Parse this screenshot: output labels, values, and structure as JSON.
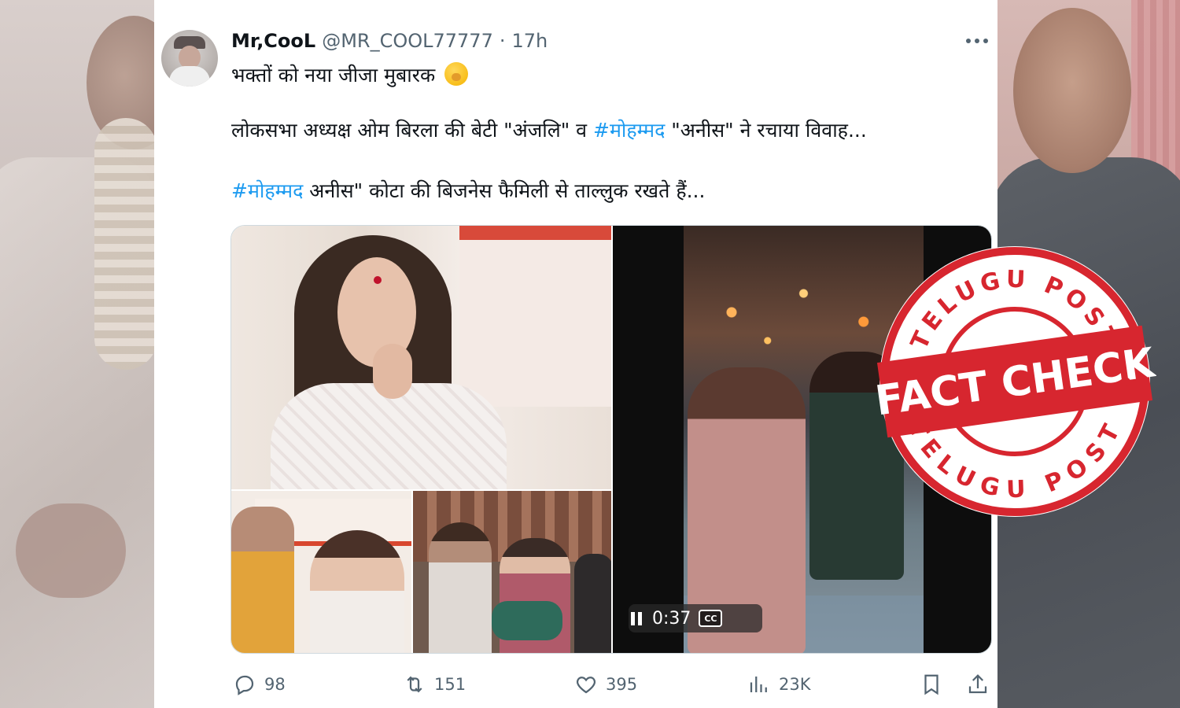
{
  "tweet": {
    "display_name": "Mr,CooL",
    "handle": "@MR_COOL77777",
    "separator": "·",
    "time": "17h",
    "line1": "भक्तों को नया जीजा मुबारक",
    "line2_a": "लोकसभा अध्यक्ष ओम बिरला की बेटी \"अंजलि\" व ",
    "line2_tag": "#मोहम्मद",
    "line2_b": " \"अनीस\" ने रचाया विवाह...",
    "line3_tag": "#मोहम्मद",
    "line3_b": " अनीस\" कोटा की बिजनेस फैमिली से ताल्लुक रखते हैं..."
  },
  "media": {
    "video_time": "0:37",
    "cc_label": "CC"
  },
  "actions": {
    "replies": "98",
    "reposts": "151",
    "likes": "395",
    "views": "23K"
  },
  "stamp": {
    "top_text": "TELUGU POST",
    "center_text": "FACT CHECK",
    "bottom_text": "TELUGU POST",
    "color": "#d7262f"
  },
  "colors": {
    "hashtag": "#1d9bf0",
    "text": "#0f1419",
    "muted": "#536471"
  }
}
